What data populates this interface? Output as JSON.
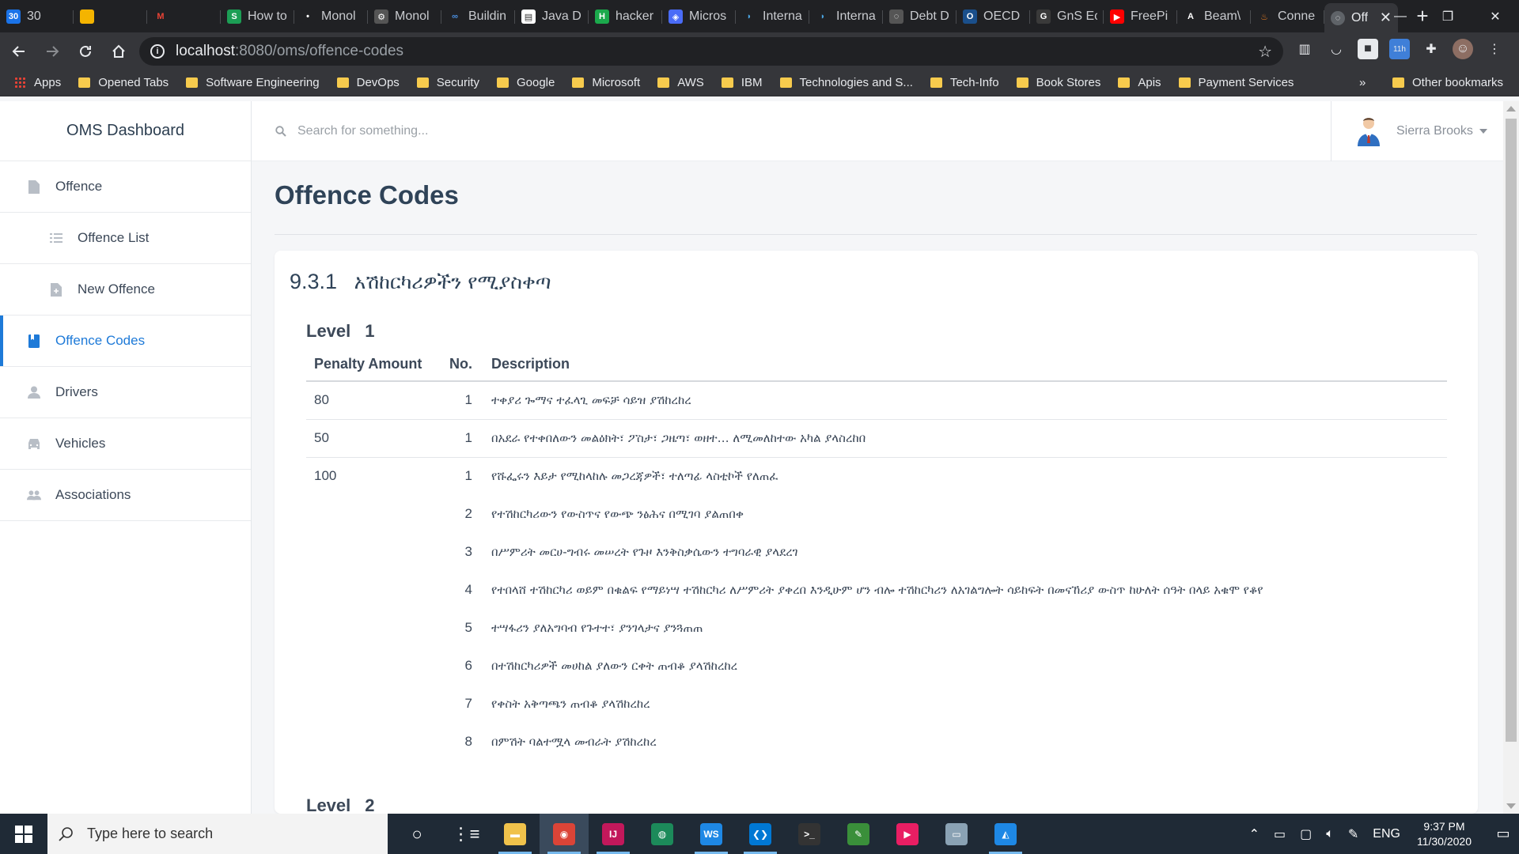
{
  "browser": {
    "tabs": [
      {
        "label": "30",
        "color": "#1a73e8",
        "fav": "30"
      },
      {
        "label": "",
        "color": "#f4b400",
        "fav": ""
      },
      {
        "label": "",
        "color": "#202124",
        "fav": "M",
        "favColor": "#ea4335"
      },
      {
        "label": "How to",
        "color": "#1c9e55",
        "fav": "S"
      },
      {
        "label": "Monol",
        "color": "#202124",
        "fav": "•"
      },
      {
        "label": "Monol",
        "color": "#555",
        "fav": "⚙"
      },
      {
        "label": "Buildin",
        "color": "#202124",
        "fav": "∞",
        "favColor": "#4a90e2"
      },
      {
        "label": "Java D",
        "color": "#fff",
        "fav": "▤",
        "favColor": "#333"
      },
      {
        "label": "hacker",
        "color": "#1ba94c",
        "fav": "H"
      },
      {
        "label": "Micros",
        "color": "#4a6cf7",
        "fav": "◈"
      },
      {
        "label": "Interna",
        "color": "#202124",
        "fav": "◗",
        "favColor": "#4aa3df"
      },
      {
        "label": "Interna",
        "color": "#202124",
        "fav": "◗",
        "favColor": "#4aa3df"
      },
      {
        "label": "Debt D",
        "color": "#555",
        "fav": "◌"
      },
      {
        "label": "OECD",
        "color": "#1a4f8b",
        "fav": "O"
      },
      {
        "label": "GnS Ec",
        "color": "#3a3a3a",
        "fav": "G"
      },
      {
        "label": "FreePi",
        "color": "#ff0000",
        "fav": "▶"
      },
      {
        "label": "Beam\\",
        "color": "#202124",
        "fav": "A"
      },
      {
        "label": "Conne",
        "color": "#202124",
        "fav": "♨",
        "favColor": "#e77e23"
      }
    ],
    "active_tab": {
      "label": "Off",
      "close": "✕"
    },
    "new_tab": "+",
    "window_controls": {
      "minimize": "—",
      "maximize": "❐",
      "close": "✕"
    },
    "url": {
      "host": "localhost",
      "path": ":8080/oms/offence-codes"
    },
    "bookmarks": [
      {
        "label": "Apps",
        "icon": "apps-grid-icon"
      },
      {
        "label": "Opened Tabs"
      },
      {
        "label": "Software Engineering"
      },
      {
        "label": "DevOps"
      },
      {
        "label": "Security"
      },
      {
        "label": "Google"
      },
      {
        "label": "Microsoft"
      },
      {
        "label": "AWS"
      },
      {
        "label": "IBM"
      },
      {
        "label": "Technologies and S..."
      },
      {
        "label": "Tech-Info"
      },
      {
        "label": "Book Stores"
      },
      {
        "label": "Apis"
      },
      {
        "label": "Payment Services"
      }
    ],
    "bookmarks_more": "»",
    "other_bookmarks": "Other bookmarks"
  },
  "app": {
    "brand": "OMS Dashboard",
    "nav": [
      {
        "label": "Offence",
        "icon": "document-icon",
        "sub": false,
        "active": false
      },
      {
        "label": "Offence List",
        "icon": "list-icon",
        "sub": true,
        "active": false
      },
      {
        "label": "New Offence",
        "icon": "add-document-icon",
        "sub": true,
        "active": false
      },
      {
        "label": "Offence Codes",
        "icon": "book-icon",
        "sub": false,
        "active": true
      },
      {
        "label": "Drivers",
        "icon": "person-icon",
        "sub": false,
        "active": false
      },
      {
        "label": "Vehicles",
        "icon": "car-icon",
        "sub": false,
        "active": false
      },
      {
        "label": "Associations",
        "icon": "group-icon",
        "sub": false,
        "active": false
      }
    ],
    "search": {
      "placeholder": "Search for something..."
    },
    "user": {
      "name": "Sierra Brooks"
    },
    "page_title": "Offence Codes",
    "section": {
      "number": "9.3.1",
      "title": "አሽከርካሪዎችን የሚያስቀጣ"
    },
    "table_headers": {
      "penalty": "Penalty Amount",
      "no": "No.",
      "description": "Description"
    },
    "levels": [
      {
        "label": "Level",
        "number": "1",
        "rows": [
          {
            "penalty": "80",
            "no": "1",
            "description": "ተቀያሪ ጐማና ተፈላጊ መፍቻ ሳይዝ ያሽከረከረ",
            "border": true
          },
          {
            "penalty": "50",
            "no": "1",
            "description": "በአደራ የተቀበለውን መልዕክት፣ ፖስታ፣ ጋዜጣ፣ ወዘተ… ለሚመለከተው አካል ያላስረከበ",
            "border": true
          },
          {
            "penalty": "100",
            "no": "1",
            "description": "የሹፌሩን እይታ የሚከላከሉ መጋረጃዎች፣ ተለጣፊ ላስቲኮች የለጠፈ",
            "border": false
          },
          {
            "penalty": "",
            "no": "2",
            "description": "የተሽከርካሪውን የውስጥና የውጭ ንፅሕና በሚገባ ያልጠበቀ",
            "border": false
          },
          {
            "penalty": "",
            "no": "3",
            "description": "በሥምሪት መርሀ-ግብሩ መሠረት የጉዞ እንቅስቃሴውን ተግባራዊ ያላደረገ",
            "border": false
          },
          {
            "penalty": "",
            "no": "4",
            "description": "የተበላሸ ተሽከርካሪ ወይም በቁልፍ የማይነሣ ተሽከርካሪ ለሥምሪት ያቀረበ እንዲሁም ሆን ብሎ ተሽከርካሪን ለአገልግሎት ሳይከፍት በመናኸሪያ ውስጥ ከሁለት ሰዓት በላይ አቁሞ የቆየ",
            "border": false
          },
          {
            "penalty": "",
            "no": "5",
            "description": "ተሣፋሪን ያለአግባብ የጉተተ፣ ያንገላታና ያንጓጠጠ",
            "border": false
          },
          {
            "penalty": "",
            "no": "6",
            "description": "በተሽከርካሪዎች መሀከል ያለውን ርቀት ጠብቆ ያላሽከረከረ",
            "border": false
          },
          {
            "penalty": "",
            "no": "7",
            "description": "የቀስት አቅጣጫን ጠብቆ ያላሽከረከረ",
            "border": false
          },
          {
            "penalty": "",
            "no": "8",
            "description": "በምሽት ባልተሟላ መብራት ያሽከረከረ",
            "border": false
          }
        ]
      },
      {
        "label": "Level",
        "number": "2",
        "rows": []
      }
    ]
  },
  "taskbar": {
    "search_placeholder": "Type here to search",
    "apps": [
      {
        "name": "task-view",
        "glyph": "○",
        "color": "transparent"
      },
      {
        "name": "timeline",
        "glyph": "⋮≡",
        "color": "transparent"
      },
      {
        "name": "file-explorer",
        "glyph": "▬",
        "color": "#f0c24b",
        "running": true
      },
      {
        "name": "chrome",
        "glyph": "◉",
        "color": "#db4437",
        "running": true,
        "active": true
      },
      {
        "name": "intellij",
        "glyph": "IJ",
        "color": "#c2185b",
        "running": true
      },
      {
        "name": "gitkraken",
        "glyph": "◍",
        "color": "#1c8a5a"
      },
      {
        "name": "webstorm",
        "glyph": "WS",
        "color": "#1e88e5",
        "running": true
      },
      {
        "name": "vscode",
        "glyph": "❮❯",
        "color": "#0078d4",
        "running": true
      },
      {
        "name": "terminal",
        "glyph": ">_",
        "color": "#333"
      },
      {
        "name": "notepad",
        "glyph": "✎",
        "color": "#3a8f3a"
      },
      {
        "name": "media",
        "glyph": "▶",
        "color": "#e91e63"
      },
      {
        "name": "laptop",
        "glyph": "▭",
        "color": "#8aa2b4"
      },
      {
        "name": "photos",
        "glyph": "◭",
        "color": "#1e88e5",
        "running": true
      }
    ],
    "tray": {
      "language": "ENG",
      "time": "9:37 PM",
      "date": "11/30/2020"
    }
  }
}
